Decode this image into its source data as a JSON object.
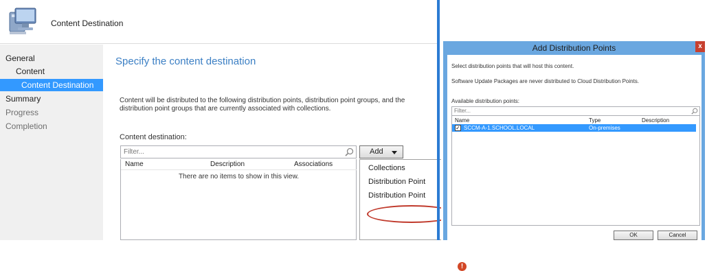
{
  "wizard": {
    "title": "Content Destination",
    "nav": [
      {
        "label": "General"
      },
      {
        "label": "Content"
      },
      {
        "label": "Content Destination"
      },
      {
        "label": "Summary"
      },
      {
        "label": "Progress"
      },
      {
        "label": "Completion"
      }
    ],
    "heading": "Specify the content destination",
    "description": "Content will be distributed to the following distribution points, distribution point groups, and the distribution point groups that are currently associated with collections.",
    "content_destination_label": "Content destination:",
    "filter_placeholder": "Filter...",
    "table_columns": [
      "Name",
      "Description",
      "Associations"
    ],
    "empty_message": "There are no items to show in this view.",
    "add_button": "Add",
    "add_menu": [
      "Collections",
      "Distribution Point",
      "Distribution Point"
    ],
    "error_icon": "!"
  },
  "dialog": {
    "title": "Add Distribution Points",
    "close": "x",
    "instruction": "Select distribution points that will host this content.",
    "note": "Software Update Packages are never distributed to Cloud Distribution Points.",
    "available_label": "Available distribution points:",
    "filter_placeholder": "Filter...",
    "columns": [
      "Name",
      "Type",
      "Description"
    ],
    "rows": [
      {
        "checked": true,
        "name": "SCCM-A-1.SCHOOL.LOCAL",
        "type": "On-premises",
        "description": ""
      }
    ],
    "ok_button": "OK",
    "cancel_button": "Cancel"
  },
  "colors": {
    "accent": "#3399ff",
    "heading": "#3b7fc4",
    "highlight": "#c0392b"
  }
}
